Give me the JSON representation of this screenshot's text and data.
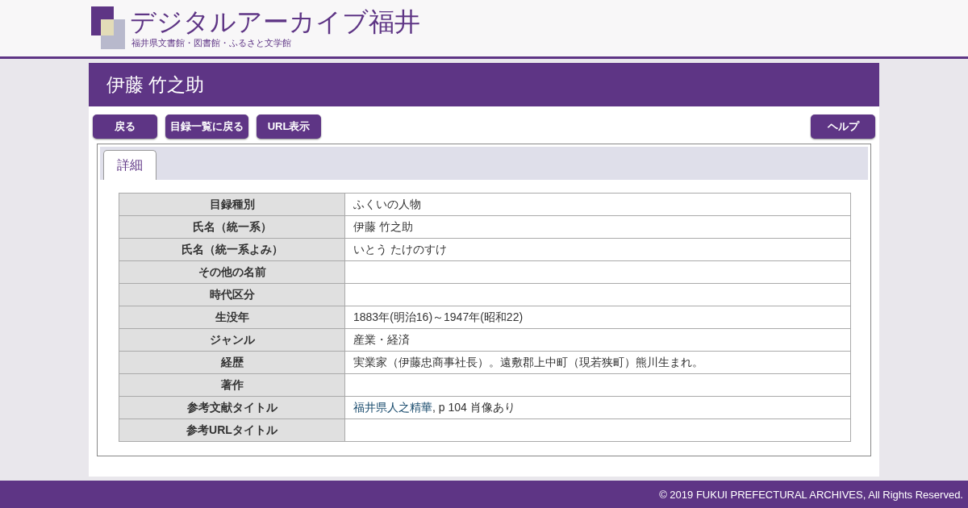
{
  "logo": {
    "title": "デジタルアーカイブ福井",
    "subtitle": "福井県文書館・図書館・ふるさと文学館"
  },
  "heading": "伊藤 竹之助",
  "buttons_left": [
    "戻る",
    "目録一覧に戻る",
    "URL表示"
  ],
  "buttons_right": [
    "ヘルプ"
  ],
  "tabs": [
    {
      "label": "詳細",
      "selected": true
    }
  ],
  "rows": [
    {
      "label": "目録種別",
      "value": "ふくいの人物"
    },
    {
      "label": "氏名（統一系）",
      "value": "伊藤 竹之助"
    },
    {
      "label": "氏名（統一系よみ）",
      "value": "いとう たけのすけ"
    },
    {
      "label": "その他の名前"
    },
    {
      "label": "時代区分"
    },
    {
      "label": "生没年",
      "value": "1883年(明治16)～1947年(昭和22)"
    },
    {
      "label": "ジャンル",
      "value": "産業・経済"
    },
    {
      "label": "経歴",
      "value": "実業家（伊藤忠商事社長）。遠敷郡上中町（現若狭町）熊川生まれ。"
    },
    {
      "label": "著作"
    },
    {
      "label": "参考文献タイトル",
      "link": "福井県人之精華",
      "value": ", p 104 肖像あり"
    },
    {
      "label": "参考URLタイトル"
    }
  ],
  "footer": "© 2019 FUKUI PREFECTURAL ARCHIVES, All Rights Reserved."
}
